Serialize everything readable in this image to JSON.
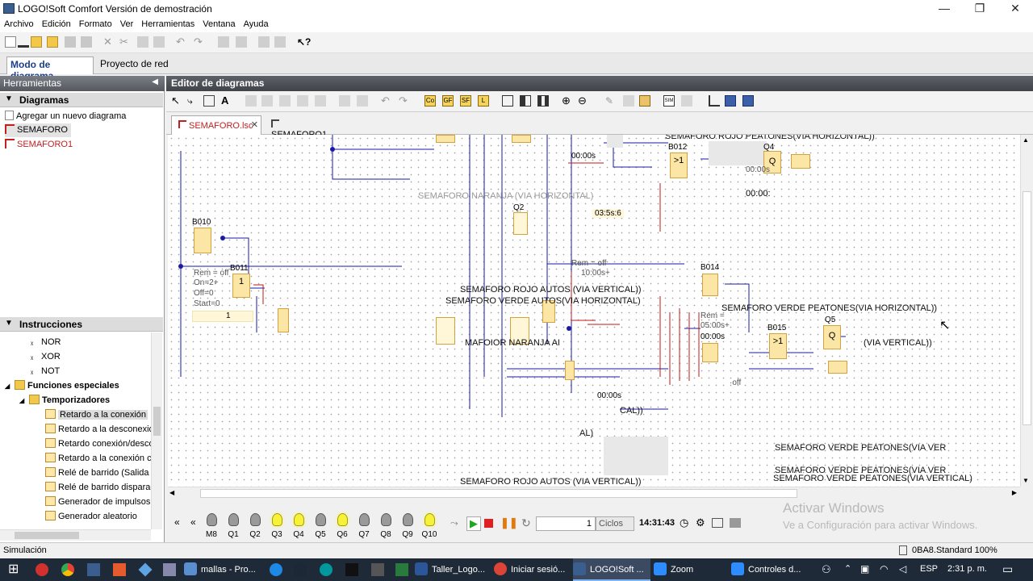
{
  "window": {
    "title": "LOGO!Soft Comfort Versión de demostración",
    "minimize": "—",
    "maximize": "❐",
    "close": "✕"
  },
  "menu": [
    "Archivo",
    "Edición",
    "Formato",
    "Ver",
    "Herramientas",
    "Ventana",
    "Ayuda"
  ],
  "mode_tabs": [
    "Modo de diagrama",
    "Proyecto de red"
  ],
  "left_panel": {
    "title": "Herramientas",
    "diagrams_section": "Diagramas",
    "diagram_items": [
      "Agregar un nuevo diagrama",
      "SEMAFORO",
      "SEMAFORO1"
    ],
    "instructions_section": "Instrucciones",
    "instruction_items": [
      {
        "label": "NOR",
        "level": 3,
        "kind": "gate"
      },
      {
        "label": "XOR",
        "level": 3,
        "kind": "gate"
      },
      {
        "label": "NOT",
        "level": 3,
        "kind": "gate"
      },
      {
        "label": "Funciones especiales",
        "level": 1,
        "kind": "folder"
      },
      {
        "label": "Temporizadores",
        "level": 2,
        "kind": "folder"
      },
      {
        "label": "Retardo a la conexión",
        "level": 3,
        "kind": "timer",
        "selected": true
      },
      {
        "label": "Retardo a la desconexión",
        "level": 3,
        "kind": "timer"
      },
      {
        "label": "Retardo conexión/descon",
        "level": 3,
        "kind": "timer"
      },
      {
        "label": "Retardo a la conexión co",
        "level": 3,
        "kind": "timer"
      },
      {
        "label": "Relé de barrido (Salida de",
        "level": 3,
        "kind": "timer"
      },
      {
        "label": "Relé de barrido disparado",
        "level": 3,
        "kind": "timer"
      },
      {
        "label": "Generador de impulsos as",
        "level": 3,
        "kind": "timer"
      },
      {
        "label": "Generador aleatorio",
        "level": 3,
        "kind": "timer"
      }
    ]
  },
  "editor": {
    "title": "Editor de diagramas",
    "doc_tabs": [
      {
        "label": "SEMAFORO.lsc",
        "active": true
      },
      {
        "label": "SEMAFORO1",
        "active": false
      }
    ],
    "blocks": [
      "B010",
      "B011",
      "B012",
      "B014",
      "B015",
      "Q2",
      "Q4",
      "Q5"
    ],
    "block_symbols": [
      ">1",
      "1",
      "Q",
      "Q",
      ">1",
      "Q"
    ],
    "params": [
      "Rem = off",
      "On=2+",
      "Off=0",
      "Start=0",
      "1",
      "00:00s",
      "00:00:",
      "10:00s+",
      "00:00s",
      "Rem =",
      "05:00s+",
      "00:00s",
      "03:5s:6",
      "Rem = off",
      "00:00s",
      "·off"
    ],
    "labels": [
      "SEMAFORO ROJO PEATONES(VIA HORIZONTAL))",
      "SEMAFORO NARANJA (VIA HORIZONTAL)",
      "SEMAFORO ROJO AUTOS (VIA VERTICAL))",
      "SEMAFORO VERDE AUTOS(VIA HORIZONTAL)",
      "SEMAFORO VERDE PEATONES(VIA HORIZONTAL))",
      "MAFOIOR NARANJA AI",
      "(VIA VERTICAL))",
      "CAL))",
      "AL)",
      "SEMAFORO VERDE PEATONES(VIA VERTICAL)",
      "SEMAFORO VERDE PEATONES(VIA VER",
      "SEMAFORO ROJO AUTOS (VIA VERTICAL))"
    ]
  },
  "simulation": {
    "lamps": [
      {
        "label": "M8",
        "on": false
      },
      {
        "label": "Q1",
        "on": false
      },
      {
        "label": "Q2",
        "on": false
      },
      {
        "label": "Q3",
        "on": true
      },
      {
        "label": "Q4",
        "on": true
      },
      {
        "label": "Q5",
        "on": false
      },
      {
        "label": "Q6",
        "on": true
      },
      {
        "label": "Q7",
        "on": false
      },
      {
        "label": "Q8",
        "on": false
      },
      {
        "label": "Q9",
        "on": false
      },
      {
        "label": "Q10",
        "on": true
      }
    ],
    "cycles_value": "1",
    "cycles_label": "Ciclos",
    "time": "14:31:43"
  },
  "watermark": {
    "line1": "Activar Windows",
    "line2": "Ve a Configuración para activar Windows."
  },
  "status": {
    "left": "Simulación",
    "right": "0BA8.Standard 100%"
  },
  "taskbar": {
    "items": [
      "mallas - Pro...",
      "Taller_Logo...",
      "Iniciar sesió...",
      "LOGO!Soft ...",
      "Zoom",
      "Controles d..."
    ],
    "lang": "ESP",
    "clock": "2:31 p. m."
  },
  "colors": {
    "accent": "#1b3f8a",
    "block_fill": "#fce6a6",
    "wire_blue": "#1a1aa6",
    "wire_red": "#c11818",
    "lamp_on": "#f6f23a"
  }
}
